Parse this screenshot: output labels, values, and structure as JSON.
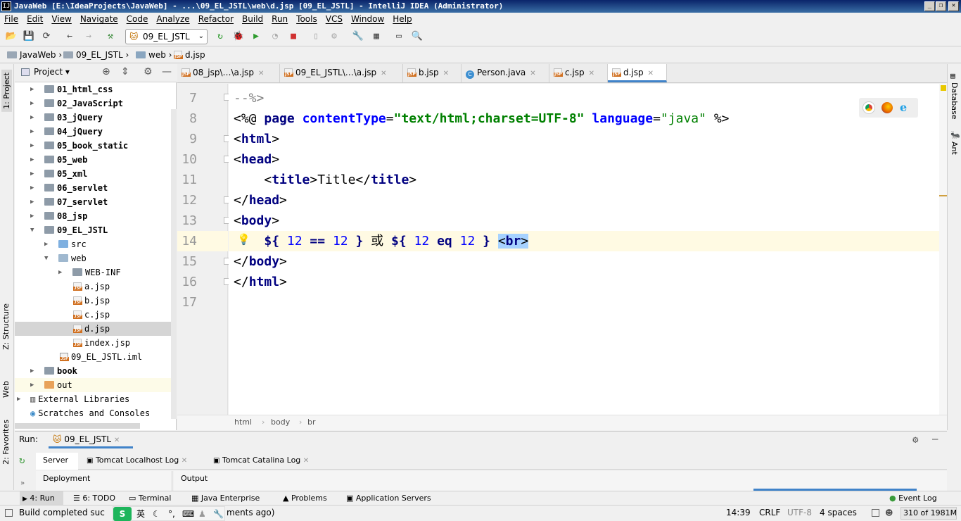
{
  "window": {
    "title": "JavaWeb [E:\\IdeaProjects\\JavaWeb] - ...\\09_EL_JSTL\\web\\d.jsp [09_EL_JSTL] - IntelliJ IDEA (Administrator)",
    "logo": "IJ"
  },
  "menu": [
    "File",
    "Edit",
    "View",
    "Navigate",
    "Code",
    "Analyze",
    "Refactor",
    "Build",
    "Run",
    "Tools",
    "VCS",
    "Window",
    "Help"
  ],
  "toolbar": {
    "run_config": "09_EL_JSTL"
  },
  "breadcrumb": [
    "JavaWeb",
    "09_EL_JSTL",
    "web",
    "d.jsp"
  ],
  "left_stripe": {
    "project": "1: Project",
    "structure": "Z: Structure",
    "web": "Web",
    "favorites": "2: Favorites"
  },
  "right_stripe": {
    "database": "Database",
    "ant": "Ant"
  },
  "project": {
    "title": "Project",
    "items": [
      {
        "label": "01_html_css"
      },
      {
        "label": "02_JavaScript"
      },
      {
        "label": "03_jQuery"
      },
      {
        "label": "04_jQuery"
      },
      {
        "label": "05_book_static"
      },
      {
        "label": "05_web"
      },
      {
        "label": "05_xml"
      },
      {
        "label": "06_servlet"
      },
      {
        "label": "07_servlet"
      },
      {
        "label": "08_jsp"
      },
      {
        "label": "09_EL_JSTL"
      },
      {
        "label": "src"
      },
      {
        "label": "web"
      },
      {
        "label": "WEB-INF"
      },
      {
        "label": "a.jsp"
      },
      {
        "label": "b.jsp"
      },
      {
        "label": "c.jsp"
      },
      {
        "label": "d.jsp"
      },
      {
        "label": "index.jsp"
      },
      {
        "label": "09_EL_JSTL.iml"
      },
      {
        "label": "book"
      },
      {
        "label": "out"
      },
      {
        "label": "External Libraries"
      },
      {
        "label": "Scratches and Consoles"
      }
    ]
  },
  "tabs": [
    {
      "label": "08_jsp\\…\\a.jsp"
    },
    {
      "label": "09_EL_JSTL\\…\\a.jsp"
    },
    {
      "label": "b.jsp"
    },
    {
      "label": "Person.java"
    },
    {
      "label": "c.jsp"
    },
    {
      "label": "d.jsp"
    }
  ],
  "code": {
    "line_numbers": [
      "7",
      "8",
      "9",
      "10",
      "11",
      "12",
      "13",
      "14",
      "15",
      "16",
      "17"
    ],
    "l7": "--%>",
    "l8": {
      "open": "<%@ ",
      "page": "page",
      "attr1": "contentType",
      "eq": "=",
      "val1": "\"text/html;charset=UTF-8\"",
      "attr2": "language",
      "val2": "\"java\"",
      "close": " %>"
    },
    "tag_html": "html",
    "tag_head": "head",
    "tag_title": "title",
    "title_text": "Title",
    "tag_body": "body",
    "l14": {
      "d1": "${",
      "n1": "12",
      "op1": "==",
      "n2": "12",
      "c1": "}",
      "or": "或",
      "d2": "${",
      "n3": "12",
      "op2": "eq",
      "n4": "12",
      "c2": "}",
      "br": "br"
    }
  },
  "editor_breadcrumb": [
    "html",
    "body",
    "br"
  ],
  "run": {
    "label": "Run:",
    "config": "09_EL_JSTL",
    "tabs": [
      "Server",
      "Tomcat Localhost Log",
      "Tomcat Catalina Log"
    ],
    "deployment": "Deployment",
    "output": "Output"
  },
  "bottom_tools": [
    "4: Run",
    "6: TODO",
    "Terminal",
    "Java Enterprise",
    "Problems",
    "Application Servers",
    "Event Log"
  ],
  "status": {
    "message": "Build completed suc",
    "message_tail": "ments ago)",
    "ime": "英",
    "position": "14:39",
    "line_sep": "CRLF",
    "encoding": "UTF-8",
    "indent": "4 spaces",
    "memory": "310 of 1981M"
  },
  "colors": {
    "title_bar": "#0a246a",
    "caret_line": "#fffae3",
    "selected_row": "#d5d5d5",
    "tag": "#000080",
    "string": "#008000",
    "number": "#0000ff",
    "selection": "#a6d2ff"
  }
}
